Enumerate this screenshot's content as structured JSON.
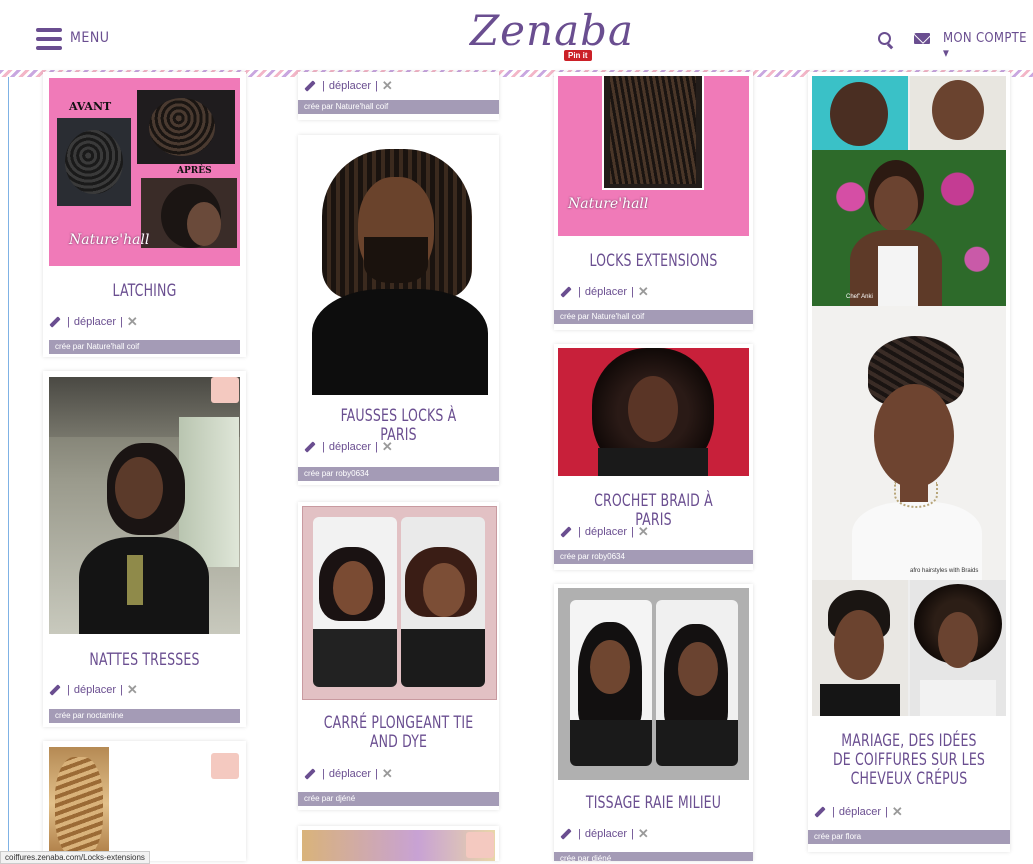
{
  "header": {
    "menu_label": "MENU",
    "logo": "Zenaba",
    "pinit": "Pin it",
    "account_label": "MON COMPTE ▾"
  },
  "actions": {
    "move_label": "déplacer",
    "sep": "|",
    "delete_glyph": "✕"
  },
  "cards": {
    "latching": {
      "title": "LATCHING",
      "credit": "crée par Nature'hall coif",
      "img_avant": "AVANT",
      "img_apres": "APRÈS",
      "img_logo": "Nature'hall"
    },
    "col2_top": {
      "credit": "crée par Nature'hall coif"
    },
    "locks_ext": {
      "title": "LOCKS EXTENSIONS",
      "credit": "crée par Nature'hall coif",
      "img_logo": "Nature'hall"
    },
    "fausses": {
      "title": "FAUSSES LOCKS À PARIS",
      "credit": "crée par roby0634"
    },
    "crochet": {
      "title": "CROCHET BRAID À PARIS",
      "credit": "crée par roby0634"
    },
    "nattes": {
      "title": "NATTES TRESSES",
      "credit": "crée par noctamine"
    },
    "carre": {
      "title": "CARRÉ PLONGEANT TIE AND DYE",
      "credit": "crée par djéné"
    },
    "tissage": {
      "title": "TISSAGE RAIE MILIEU",
      "credit": "crée par djéné"
    },
    "mariage": {
      "title": "MARIAGE, DES IDÉES DE COIFFURES SUR LES CHEVEUX CRÉPUS",
      "credit": "crée par flora",
      "img_caption1": "Chef' Anki",
      "img_caption2": "afro hairstyles with Braids"
    }
  },
  "status_url": "coiffures.zenaba.com/Locks-extensions",
  "colors": {
    "brand": "#6a4e90",
    "credit_bar": "#a49bb6",
    "pink": "#f07ab8"
  }
}
